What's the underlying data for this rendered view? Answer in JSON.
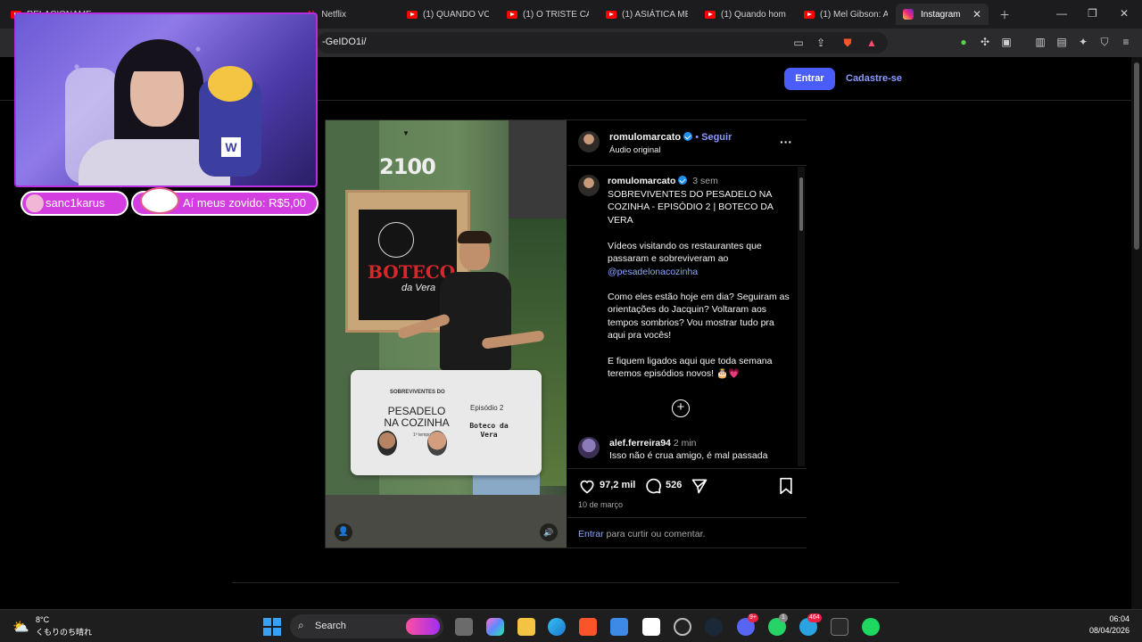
{
  "browser": {
    "tabs": [
      {
        "label": "RELACIONAMEN",
        "type": "youtube"
      },
      {
        "label": "Netflix",
        "type": "netflix"
      },
      {
        "label": "(1) QUANDO VO",
        "type": "youtube"
      },
      {
        "label": "(1) O TRISTE CA",
        "type": "youtube"
      },
      {
        "label": "(1) ASIÁTICA ME",
        "type": "youtube"
      },
      {
        "label": "(1) Quando hom",
        "type": "youtube"
      },
      {
        "label": "(1) Mel Gibson: A",
        "type": "youtube"
      },
      {
        "label": "Instagram",
        "type": "instagram",
        "active": true
      }
    ],
    "url_fragment": "-GeIDO1i/"
  },
  "instagram": {
    "header": {
      "login_label": "Entrar",
      "signup_label": "Cadastre-se"
    },
    "post": {
      "username": "romulomarcato",
      "follow_label": "Seguir",
      "audio_label": "Áudio original",
      "caption_time": "3 sem",
      "caption_title": "SOBREVIVENTES DO PESADELO NA COZINHA - EPISÓDIO 2 | BOTECO DA VERA",
      "caption_p1": "Vídeos visitando os restaurantes que passaram e sobreviveram ao",
      "caption_mention": "@pesadelonacozinha",
      "caption_p2": "Como eles estão hoje em dia? Seguiram as orientações do Jacquin? Voltaram aos tempos sombrios? Vou mostrar tudo pra aqui pra vocês!",
      "caption_p3": "E fiquem ligados aqui que toda semana teremos episódios novos! 🎂💗",
      "comment": {
        "username": "alef.ferreira94",
        "time": "2 min",
        "text": "Isso não é crua amigo, é mal passada"
      },
      "likes": "97,2 mil",
      "comments_count": "526",
      "date": "10 de março",
      "login_prompt_link": "Entrar",
      "login_prompt_text": "para curtir ou comentar.",
      "media": {
        "building_number": "2100",
        "sign_text": "BOTECO",
        "sign_subtext": "da Vera",
        "card_title_top": "SOBREVIVENTES DO",
        "card_title_main": "PESADELO NA COZINHA",
        "card_season": "1ª temporada",
        "card_episode": "Episódio 2",
        "card_place": "Boteco da Vera"
      }
    }
  },
  "overlay": {
    "chip1": "sanc1karus",
    "chip2": "Aí meus zovido: R$5,00"
  },
  "taskbar": {
    "search_label": "Search",
    "weather_temp": "8°C",
    "weather_desc": "くもりのち晴れ",
    "time": "06:04",
    "date": "08/04/2026",
    "badge_discord": "9+",
    "badge_whatsapp": "1",
    "badge_telegram": "464"
  },
  "colors": {
    "accent": "#4a5df9",
    "link": "#8ca8ff",
    "overlay_border": "#b52fe0"
  }
}
